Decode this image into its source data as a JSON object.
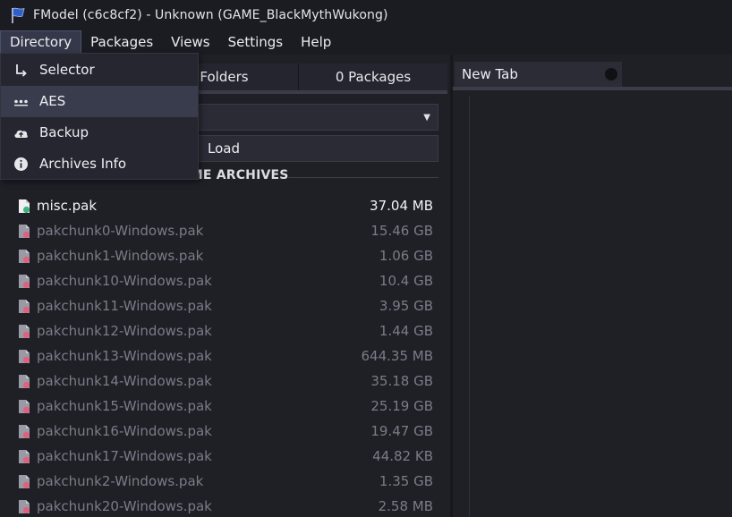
{
  "window": {
    "title": "FModel (c6c8cf2) - Unknown (GAME_BlackMythWukong)",
    "logo_icon": "flag-logo-icon"
  },
  "menubar": {
    "items": [
      {
        "label": "Directory",
        "active": true
      },
      {
        "label": "Packages"
      },
      {
        "label": "Views"
      },
      {
        "label": "Settings"
      },
      {
        "label": "Help"
      }
    ]
  },
  "directory_menu": {
    "items": [
      {
        "label": "Selector",
        "icon": "arrow-return-icon"
      },
      {
        "label": "AES",
        "icon": "key-dots-icon",
        "hover": true
      },
      {
        "label": "Backup",
        "icon": "cloud-upload-icon"
      },
      {
        "label": "Archives Info",
        "icon": "info-circle-icon"
      }
    ]
  },
  "left_panel": {
    "tabs": {
      "folders_label": "Folders",
      "packages_label": "0 Packages"
    },
    "load_label": "Load",
    "section_title": "GAME ARCHIVES",
    "archives": [
      {
        "name": "misc.pak",
        "size": "37.04 MB",
        "loaded": true
      },
      {
        "name": "pakchunk0-Windows.pak",
        "size": "15.46 GB"
      },
      {
        "name": "pakchunk1-Windows.pak",
        "size": "1.06 GB"
      },
      {
        "name": "pakchunk10-Windows.pak",
        "size": "10.4 GB"
      },
      {
        "name": "pakchunk11-Windows.pak",
        "size": "3.95 GB"
      },
      {
        "name": "pakchunk12-Windows.pak",
        "size": "1.44 GB"
      },
      {
        "name": "pakchunk13-Windows.pak",
        "size": "644.35 MB"
      },
      {
        "name": "pakchunk14-Windows.pak",
        "size": "35.18 GB"
      },
      {
        "name": "pakchunk15-Windows.pak",
        "size": "25.19 GB"
      },
      {
        "name": "pakchunk16-Windows.pak",
        "size": "19.47 GB"
      },
      {
        "name": "pakchunk17-Windows.pak",
        "size": "44.82 KB"
      },
      {
        "name": "pakchunk2-Windows.pak",
        "size": "1.35 GB"
      },
      {
        "name": "pakchunk20-Windows.pak",
        "size": "2.58 MB"
      }
    ],
    "status_colors": {
      "loaded": "#3fb27f",
      "unloaded": "#e0607e"
    }
  },
  "right_panel": {
    "tab_label": "New Tab"
  }
}
